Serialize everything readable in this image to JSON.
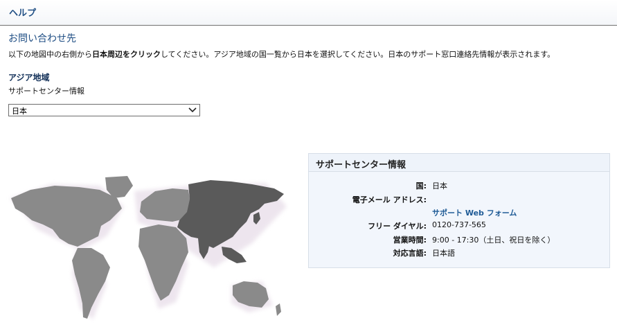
{
  "header": {
    "title": "ヘルプ"
  },
  "section": {
    "title": "お問い合わせ先",
    "instruction_prefix": "以下の地図中の右側から",
    "instruction_bold": "日本周辺をクリック",
    "instruction_suffix": "してください。アジア地域の国一覧から日本を選択してください。日本のサポート窓口連絡先情報が表示されます。"
  },
  "region": {
    "title": "アジア地域",
    "subtitle": "サポートセンター情報",
    "selected_country": "日本"
  },
  "support_panel": {
    "title": "サポートセンター情報",
    "country_label": "国:",
    "country_value": "日本",
    "email_label": "電子メール アドレス:",
    "web_form_link": "サポート Web フォーム",
    "freedial_label": "フリー ダイヤル:",
    "freedial_value": "0120-737-565",
    "hours_label": "営業時間:",
    "hours_value": "9:00 - 17:30（土日、祝日を除く）",
    "language_label": "対応言語:",
    "language_value": "日本語"
  },
  "map": {
    "highlight_region": "asia",
    "colors": {
      "land": "#8a8a8a",
      "highlight": "#5a5a5a",
      "glow": "#e6dbe7"
    }
  }
}
